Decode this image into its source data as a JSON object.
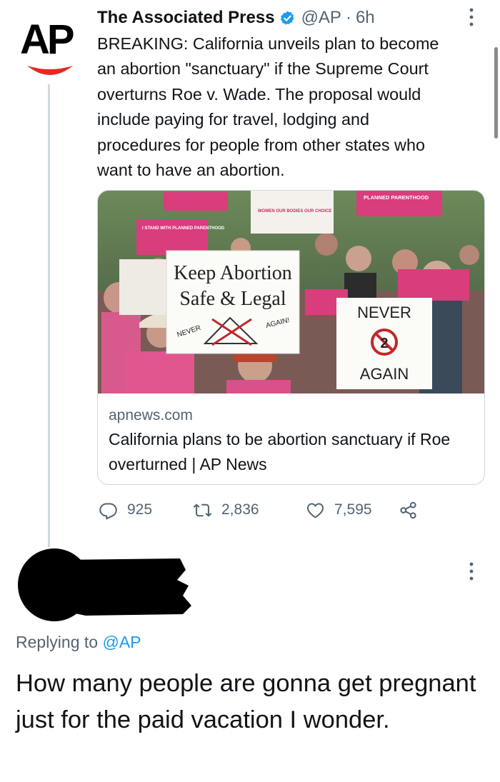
{
  "tweet": {
    "author_name": "The Associated Press",
    "handle": "@AP",
    "separator": "·",
    "time": "6h",
    "logo_text": "AP",
    "text": "BREAKING: California unveils plan to become\nan abortion \"sanctuary\" if the Supreme Court\noverturns Roe v. Wade. The proposal would\ninclude paying for travel, lodging and\nprocedures for people from other states who\nwant to have an abortion.",
    "card": {
      "domain": "apnews.com",
      "title": "California plans to be abortion sanctuary if Roe overturned | AP News",
      "image": {
        "sign_main_line1": "Keep Abortion",
        "sign_main_line2": "Safe & Legal",
        "sign_main_left": "NEVER",
        "sign_main_right": "AGAIN!",
        "sign_right_top": "NEVER",
        "sign_right_bottom": "AGAIN",
        "sign_right_number": "2",
        "sign_pink_1": "PLANNED PARENTHOOD",
        "sign_pink_2": "I STAND WITH PLANNED PARENTHOOD",
        "sign_white_top": "WOMEN OUR BODIES OUR CHOICE"
      }
    },
    "actions": {
      "replies": "925",
      "retweets": "2,836",
      "likes": "7,595"
    }
  },
  "reply": {
    "replying_prefix": "Replying to",
    "replying_mention": "@AP",
    "text": "How many people are gonna get pregnant just for the paid vacation I wonder."
  },
  "colors": {
    "accent": "#1d9bf0",
    "ap_red": "#e8281f",
    "muted": "#536471",
    "pink": "#e5457f"
  },
  "icons": [
    "verified-badge-icon",
    "more-icon",
    "reply-icon",
    "retweet-icon",
    "like-icon",
    "share-icon"
  ]
}
